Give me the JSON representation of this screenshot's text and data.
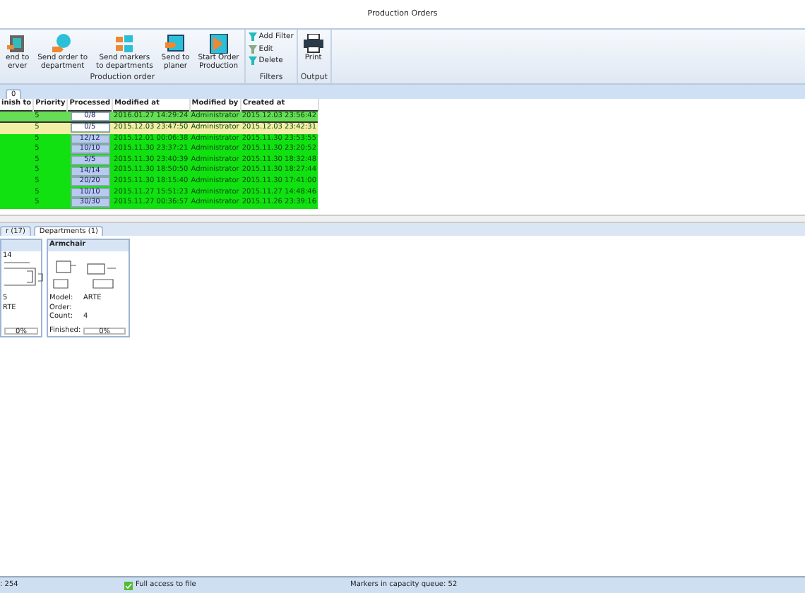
{
  "window": {
    "title": "Production Orders"
  },
  "ribbon": {
    "groups": [
      {
        "label": "Production order",
        "buttons": [
          "end to\nerver",
          "Send order to\ndepartment",
          "Send markers\nto departments",
          "Send to\nplaner",
          "Start Order\nProduction"
        ]
      },
      {
        "label": "Filters",
        "small_buttons": [
          "Add Filter",
          "Edit",
          "Delete"
        ]
      },
      {
        "label": "Output",
        "buttons": [
          "Print"
        ]
      }
    ]
  },
  "top_tabs": [
    {
      "label": "0",
      "selected": true
    }
  ],
  "table": {
    "columns": [
      "inish to",
      "Priority",
      "Processed",
      "Modified at",
      "Modified by",
      "Created at"
    ],
    "rows": [
      {
        "cells": [
          "",
          "5",
          "0/8",
          "2016.01.27 14:29:24",
          "Administrator",
          "2015.12.03 23:56:42"
        ],
        "selected": true,
        "color": "#66dd55"
      },
      {
        "cells": [
          "",
          "5",
          "0/5",
          "2015.12.03 23:47:50",
          "Administrator",
          "2015.12.03 23:42:31"
        ],
        "selected": false,
        "color": "#f2eea6"
      },
      {
        "cells": [
          "",
          "5",
          "12/12",
          "2015.12.01 00:06:38",
          "Administrator",
          "2015.11.30 23:53:55"
        ],
        "selected": false,
        "color": "#11e011"
      },
      {
        "cells": [
          "",
          "5",
          "10/10",
          "2015.11.30 23:37:21",
          "Administrator",
          "2015.11.30 23:20:52"
        ],
        "selected": false,
        "color": "#11e011"
      },
      {
        "cells": [
          "",
          "5",
          "5/5",
          "2015.11.30 23:40:39",
          "Administrator",
          "2015.11.30 18:32:48"
        ],
        "selected": false,
        "color": "#11e011"
      },
      {
        "cells": [
          "",
          "5",
          "14/14",
          "2015.11.30 18:50:50",
          "Administrator",
          "2015.11.30 18:27:44"
        ],
        "selected": false,
        "color": "#11e011"
      },
      {
        "cells": [
          "",
          "5",
          "20/20",
          "2015.11.30 18:15:40",
          "Administrator",
          "2015.11.30 17:41:00"
        ],
        "selected": false,
        "color": "#11e011"
      },
      {
        "cells": [
          "",
          "5",
          "10/10",
          "2015.11.27 15:51:23",
          "Administrator",
          "2015.11.27 14:48:46"
        ],
        "selected": false,
        "color": "#11e011"
      },
      {
        "cells": [
          "",
          "5",
          "30/30",
          "2015.11.27 00:36:57",
          "Administrator",
          "2015.11.26 23:39:16"
        ],
        "selected": false,
        "color": "#11e011"
      }
    ]
  },
  "bottom_tabs": [
    {
      "label": "r (17)",
      "selected": false
    },
    {
      "label": "Departments (1)",
      "selected": true
    }
  ],
  "cards": [
    {
      "dimension": "14",
      "lines": [
        {
          "label": "5"
        },
        {
          "value": "RTE"
        }
      ],
      "finished": "0%",
      "level": 0
    },
    {
      "title": "Armchair",
      "lines": [
        {
          "label": "Model:",
          "value": "ARTE"
        },
        {
          "label": "Order:"
        },
        {
          "label": "Count:",
          "value": "4"
        }
      ],
      "finished_label": "Finished:",
      "finished": "0%",
      "level": 0
    }
  ],
  "status_bar": [
    ": 254",
    "Full access to file",
    "Markers in capacity queue: 52"
  ]
}
